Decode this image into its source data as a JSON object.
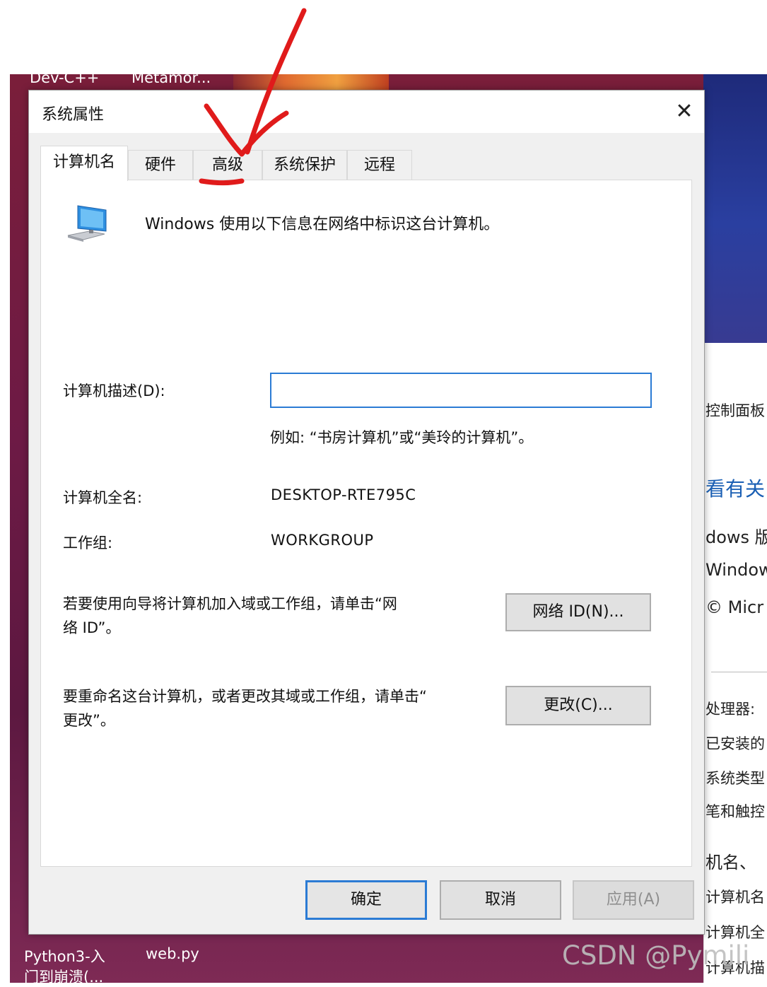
{
  "taskbar_labels": {
    "top_left_1": "Dev-C++",
    "top_left_2": "Metamor...",
    "bottom_left_1": "Python3-入",
    "bottom_left_1b": "门到崩溃(...",
    "bottom_left_2": "web.py"
  },
  "background_window": {
    "lines": [
      "控制面板",
      "看有关",
      "dows 版",
      "Window",
      "© Micr",
      "处理器:",
      "已安装的",
      "系统类型",
      "笔和触控",
      "机名、",
      "计算机名",
      "计算机全",
      "计算机描"
    ]
  },
  "dialog": {
    "title": "系统属性",
    "close_glyph": "✕",
    "tabs": [
      {
        "label": "计算机名",
        "active": true
      },
      {
        "label": "硬件",
        "active": false
      },
      {
        "label": "高级",
        "active": false
      },
      {
        "label": "系统保护",
        "active": false
      },
      {
        "label": "远程",
        "active": false
      }
    ],
    "intro_text": "Windows 使用以下信息在网络中标识这台计算机。",
    "description_label": "计算机描述(D):",
    "description_value": "",
    "description_example": "例如: “书房计算机”或“美玲的计算机”。",
    "full_name_label": "计算机全名:",
    "full_name_value": "DESKTOP-RTE795C",
    "workgroup_label": "工作组:",
    "workgroup_value": "WORKGROUP",
    "network_id_text_1": "若要使用向导将计算机加入域或工作组，请单击“网",
    "network_id_text_2": "络 ID”。",
    "network_id_button": "网络 ID(N)...",
    "rename_text_1": "要重命名这台计算机，或者更改其域或工作组，请单击“",
    "rename_text_2": "更改”。",
    "change_button": "更改(C)...",
    "ok_button": "确定",
    "cancel_button": "取消",
    "apply_button": "应用(A)"
  },
  "watermark": "CSDN @Pymili",
  "annotation_color": "#e01b1b",
  "accent_color": "#2b7bd4"
}
